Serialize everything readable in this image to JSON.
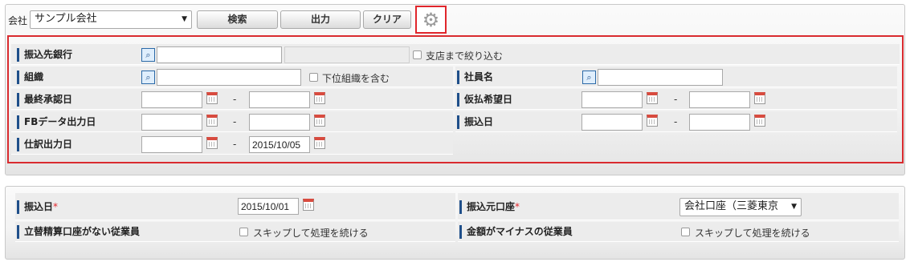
{
  "header": {
    "company_label": "会社",
    "company_value": "サンプル会社",
    "search_label": "検索",
    "export_label": "出力",
    "clear_label": "クリア"
  },
  "criteria": {
    "bank_label": "振込先銀行",
    "bank_value": "",
    "bank_name_value": "",
    "branch_filter_label": "支店まで絞り込む",
    "org_label": "組織",
    "org_value": "",
    "sub_org_label": "下位組織を含む",
    "employee_label": "社員名",
    "employee_value": "",
    "final_approval_label": "最終承認日",
    "final_approval_from": "",
    "final_approval_to": "",
    "advance_request_label": "仮払希望日",
    "advance_request_from": "",
    "advance_request_to": "",
    "fb_output_label": "FBデータ出力日",
    "fb_output_from": "",
    "fb_output_to": "",
    "transfer_date_label": "振込日",
    "transfer_date_from": "",
    "transfer_date_to": "",
    "journal_output_label": "仕訳出力日",
    "journal_output_from": "",
    "journal_output_to": "2015/10/05",
    "range_separator": "-"
  },
  "action": {
    "transfer_date_label": "振込日",
    "required_mark": "*",
    "transfer_date_value": "2015/10/01",
    "source_account_label": "振込元口座",
    "source_account_value": "会社口座（三菱東京",
    "no_account_label": "立替精算口座がない従業員",
    "skip_label_1": "スキップして処理を続ける",
    "negative_amount_label": "金額がマイナスの従業員",
    "skip_label_2": "スキップして処理を続ける"
  },
  "icons": {
    "settings": "gear-icon",
    "lookup": "magnifier-icon",
    "calendar": "calendar-icon",
    "dropdown": "chevron-down-icon"
  }
}
